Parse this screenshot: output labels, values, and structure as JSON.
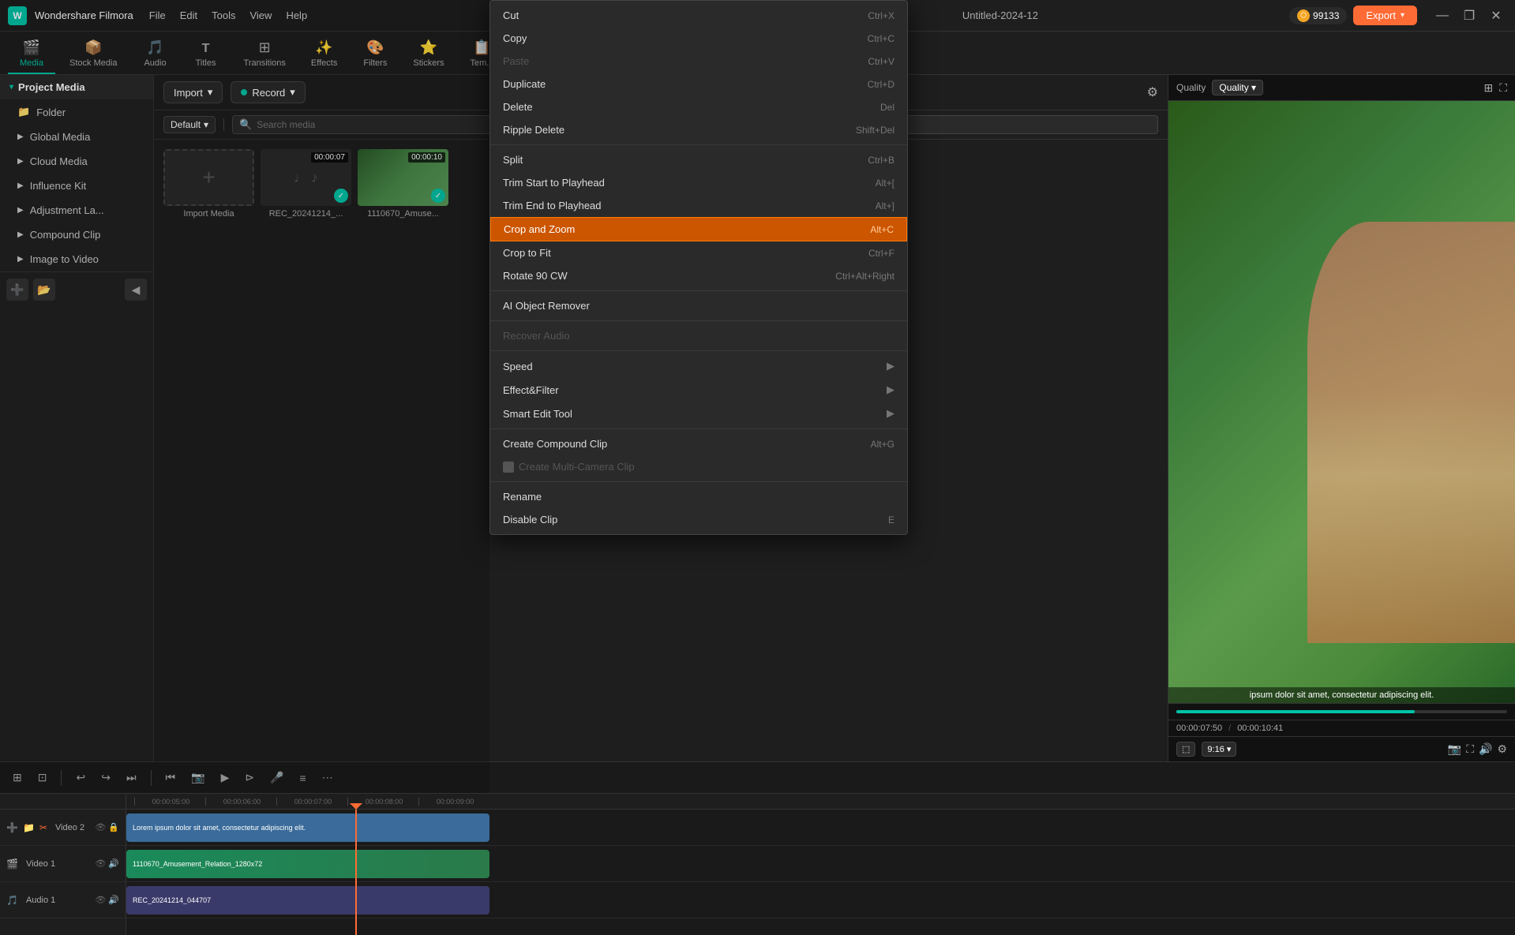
{
  "app": {
    "name": "Wondershare Filmora",
    "title": "Untitled-2024-12",
    "coins": "99133"
  },
  "titlebar": {
    "menu": [
      "File",
      "Edit",
      "Tools",
      "View",
      "Help"
    ],
    "export_label": "Export",
    "minimize": "—",
    "maximize": "❐",
    "close": "✕"
  },
  "tabs": [
    {
      "id": "media",
      "label": "Media",
      "icon": "🎬",
      "active": true
    },
    {
      "id": "stock-media",
      "label": "Stock Media",
      "icon": "📦",
      "active": false
    },
    {
      "id": "audio",
      "label": "Audio",
      "icon": "🎵",
      "active": false
    },
    {
      "id": "titles",
      "label": "Titles",
      "icon": "T",
      "active": false
    },
    {
      "id": "transitions",
      "label": "Transitions",
      "icon": "⊞",
      "active": false
    },
    {
      "id": "effects",
      "label": "Effects",
      "icon": "✨",
      "active": false
    },
    {
      "id": "filters",
      "label": "Filters",
      "icon": "🎨",
      "active": false
    },
    {
      "id": "stickers",
      "label": "Stickers",
      "icon": "⭐",
      "active": false
    },
    {
      "id": "templates",
      "label": "Tem...",
      "icon": "📋",
      "active": false
    }
  ],
  "sidebar": {
    "header": "Project Media",
    "items": [
      {
        "id": "folder",
        "label": "Folder"
      },
      {
        "id": "global-media",
        "label": "Global Media"
      },
      {
        "id": "cloud-media",
        "label": "Cloud Media"
      },
      {
        "id": "influence-kit",
        "label": "Influence Kit"
      },
      {
        "id": "adjustment-layer",
        "label": "Adjustment La..."
      },
      {
        "id": "compound-clip",
        "label": "Compound Clip"
      },
      {
        "id": "image-to-video",
        "label": "Image to Video"
      }
    ]
  },
  "media_toolbar": {
    "import_label": "Import",
    "record_label": "Record",
    "default_label": "Default",
    "search_placeholder": "Search media"
  },
  "media_items": [
    {
      "id": "import",
      "label": "Import Media",
      "type": "import"
    },
    {
      "id": "rec1",
      "label": "REC_20241214_...",
      "type": "audio",
      "time": "00:00:07"
    },
    {
      "id": "vid1",
      "label": "1110670_Amuse...",
      "type": "video",
      "time": "00:00:10"
    }
  ],
  "preview": {
    "label": "Quality",
    "caption": "ipsum dolor sit amet, consectetur adipiscing elit.",
    "time_current": "00:00:07:50",
    "time_total": "00:00:10:41",
    "aspect": "9:16",
    "progress_pct": 72
  },
  "timeline": {
    "tracks": [
      {
        "id": "video2",
        "label": "Video 2",
        "type": "text"
      },
      {
        "id": "video1",
        "label": "Video 1",
        "type": "video"
      },
      {
        "id": "audio1",
        "label": "Audio 1",
        "type": "audio"
      }
    ],
    "ruler_marks": [
      "00:00:05:00",
      "00:00:06:00",
      "00:00:07:00",
      "00:00:08:00",
      "00:00:09:00"
    ],
    "clips": {
      "video2_text": "Lorem ipsum dolor sit amet, consectetur adipiscing elit.",
      "video1_name": "1110670_Amusement_Relation_1280x72",
      "audio1_name": "REC_20241214_044707"
    }
  },
  "context_menu": {
    "items": [
      {
        "id": "cut",
        "label": "Cut",
        "shortcut": "Ctrl+X",
        "disabled": false,
        "highlighted": false,
        "submenu": false
      },
      {
        "id": "copy",
        "label": "Copy",
        "shortcut": "Ctrl+C",
        "disabled": false,
        "highlighted": false,
        "submenu": false
      },
      {
        "id": "paste",
        "label": "Paste",
        "shortcut": "Ctrl+V",
        "disabled": true,
        "highlighted": false,
        "submenu": false
      },
      {
        "id": "duplicate",
        "label": "Duplicate",
        "shortcut": "Ctrl+D",
        "disabled": false,
        "highlighted": false,
        "submenu": false
      },
      {
        "id": "delete",
        "label": "Delete",
        "shortcut": "Del",
        "disabled": false,
        "highlighted": false,
        "submenu": false
      },
      {
        "id": "ripple-delete",
        "label": "Ripple Delete",
        "shortcut": "Shift+Del",
        "disabled": false,
        "highlighted": false,
        "submenu": false
      },
      {
        "id": "sep1",
        "type": "separator"
      },
      {
        "id": "split",
        "label": "Split",
        "shortcut": "Ctrl+B",
        "disabled": false,
        "highlighted": false,
        "submenu": false
      },
      {
        "id": "trim-start",
        "label": "Trim Start to Playhead",
        "shortcut": "Alt+[",
        "disabled": false,
        "highlighted": false,
        "submenu": false
      },
      {
        "id": "trim-end",
        "label": "Trim End to Playhead",
        "shortcut": "Alt+]",
        "disabled": false,
        "highlighted": false,
        "submenu": false
      },
      {
        "id": "crop-and-zoom",
        "label": "Crop and Zoom",
        "shortcut": "Alt+C",
        "disabled": false,
        "highlighted": true,
        "submenu": false
      },
      {
        "id": "crop-to-fit",
        "label": "Crop to Fit",
        "shortcut": "Ctrl+F",
        "disabled": false,
        "highlighted": false,
        "submenu": false
      },
      {
        "id": "rotate-90",
        "label": "Rotate 90 CW",
        "shortcut": "Ctrl+Alt+Right",
        "disabled": false,
        "highlighted": false,
        "submenu": false
      },
      {
        "id": "sep2",
        "type": "separator"
      },
      {
        "id": "ai-object-remover",
        "label": "AI Object Remover",
        "shortcut": "",
        "disabled": false,
        "highlighted": false,
        "submenu": false
      },
      {
        "id": "sep3",
        "type": "separator"
      },
      {
        "id": "recover-audio",
        "label": "Recover Audio",
        "shortcut": "",
        "disabled": true,
        "highlighted": false,
        "submenu": false
      },
      {
        "id": "sep4",
        "type": "separator"
      },
      {
        "id": "speed",
        "label": "Speed",
        "shortcut": "",
        "disabled": false,
        "highlighted": false,
        "submenu": true
      },
      {
        "id": "effect-filter",
        "label": "Effect&Filter",
        "shortcut": "",
        "disabled": false,
        "highlighted": false,
        "submenu": true
      },
      {
        "id": "smart-edit-tool",
        "label": "Smart Edit Tool",
        "shortcut": "",
        "disabled": false,
        "highlighted": false,
        "submenu": true
      },
      {
        "id": "sep5",
        "type": "separator"
      },
      {
        "id": "create-compound-clip",
        "label": "Create Compound Clip",
        "shortcut": "Alt+G",
        "disabled": false,
        "highlighted": false,
        "submenu": false
      },
      {
        "id": "create-multi-camera",
        "label": "Create Multi-Camera Clip",
        "shortcut": "",
        "disabled": true,
        "highlighted": false,
        "submenu": false
      },
      {
        "id": "sep6",
        "type": "separator"
      },
      {
        "id": "rename",
        "label": "Rename",
        "shortcut": "",
        "disabled": false,
        "highlighted": false,
        "submenu": false
      },
      {
        "id": "disable-clip",
        "label": "Disable Clip",
        "shortcut": "E",
        "disabled": false,
        "highlighted": false,
        "submenu": false
      }
    ]
  }
}
